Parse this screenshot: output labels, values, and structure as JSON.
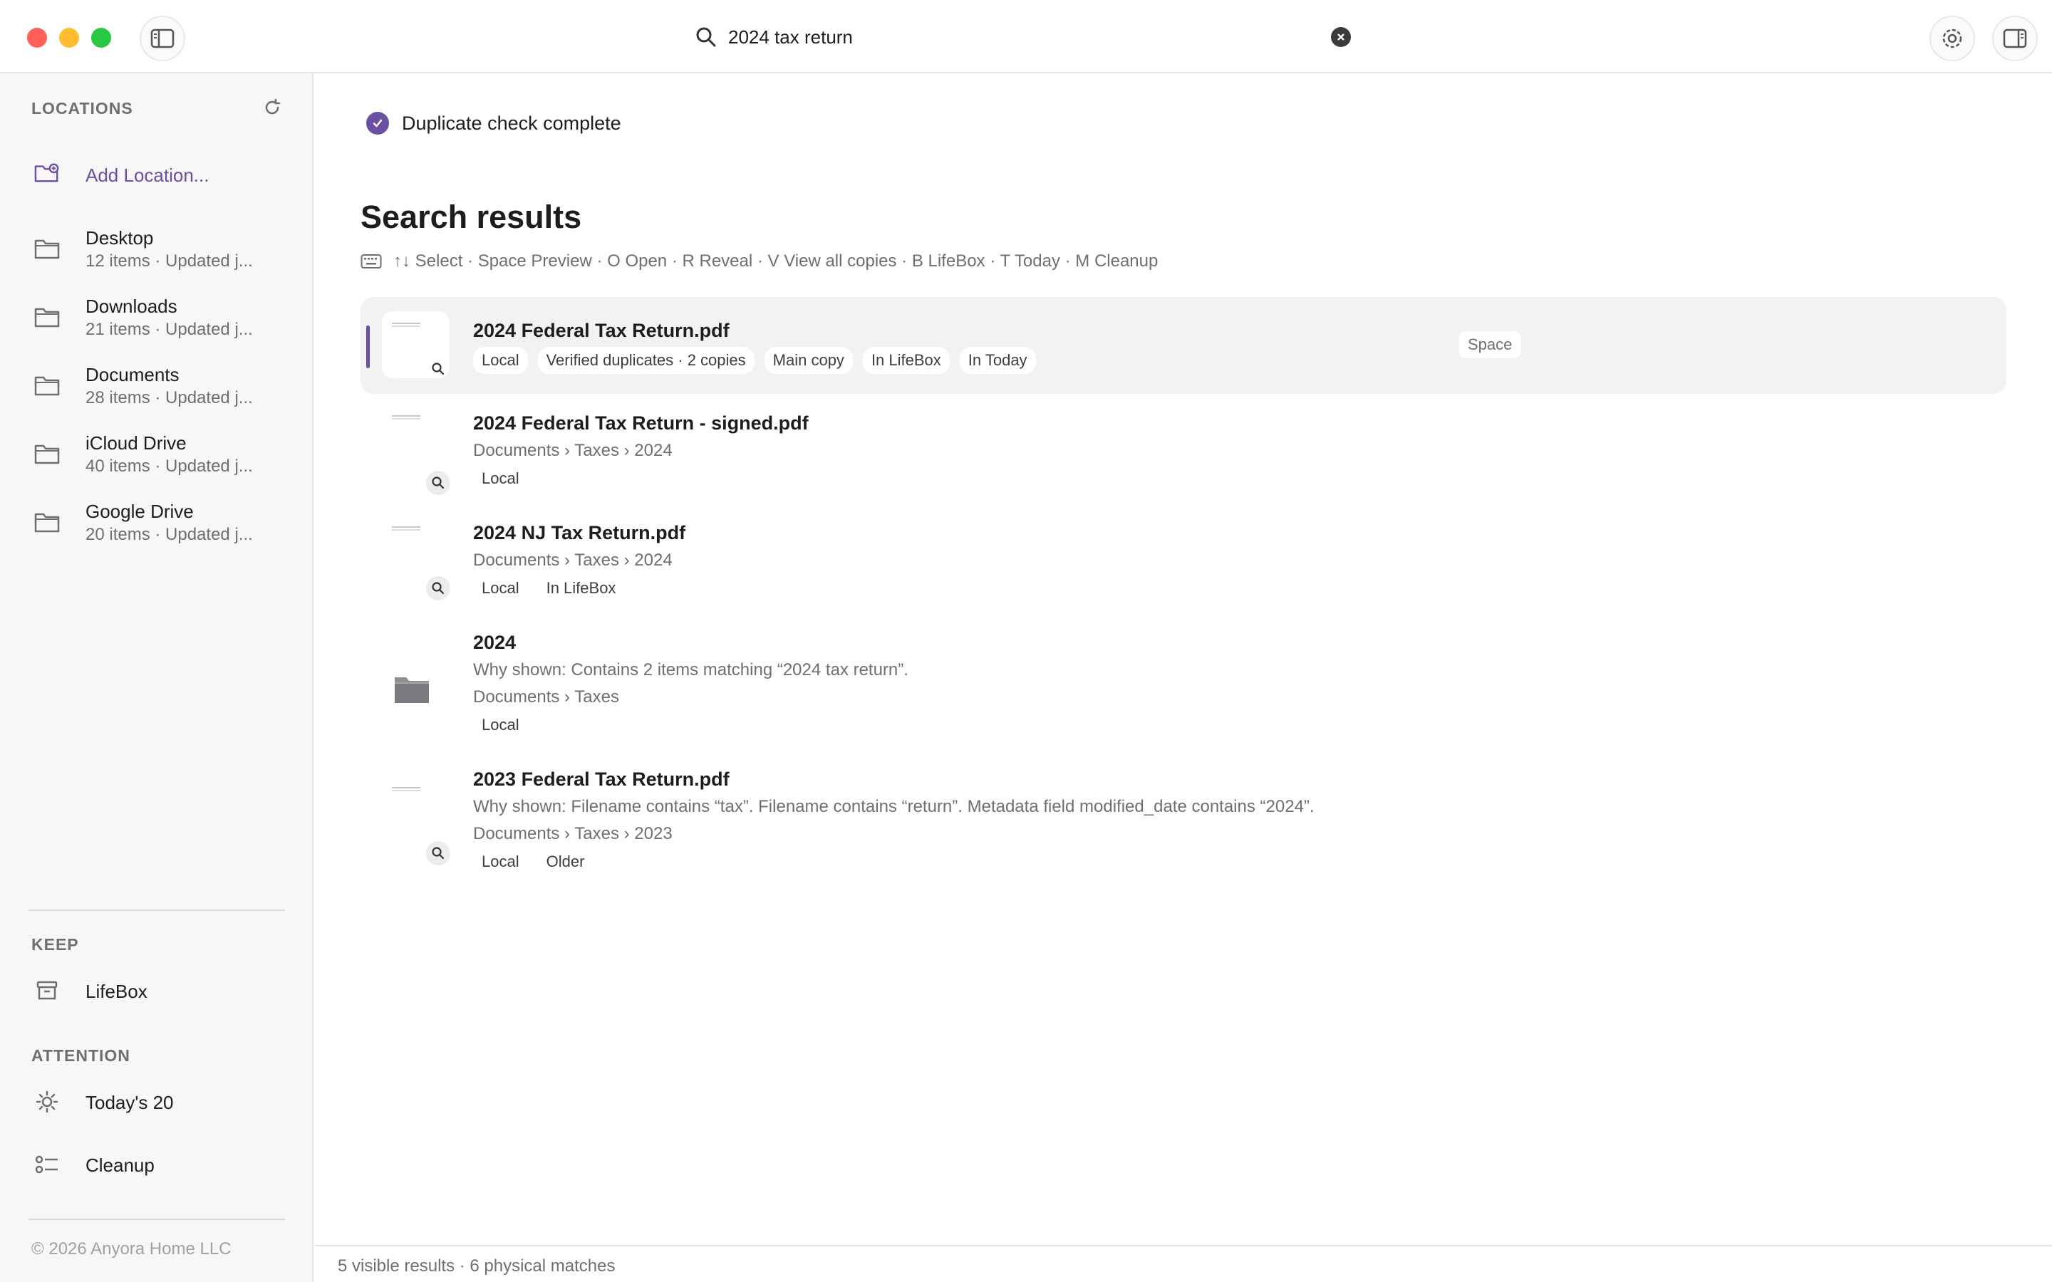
{
  "window": {
    "search_query": "2024 tax return"
  },
  "sidebar": {
    "locations_heading": "LOCATIONS",
    "add_location_label": "Add Location...",
    "locations": [
      {
        "name": "Desktop",
        "meta": "12 items · Updated j..."
      },
      {
        "name": "Downloads",
        "meta": "21 items · Updated j..."
      },
      {
        "name": "Documents",
        "meta": "28 items · Updated j..."
      },
      {
        "name": "iCloud Drive",
        "meta": "40 items · Updated j..."
      },
      {
        "name": "Google Drive",
        "meta": "20 items · Updated j..."
      }
    ],
    "keep_heading": "KEEP",
    "keep_items": [
      {
        "label": "LifeBox",
        "icon": "archive-icon"
      }
    ],
    "attention_heading": "ATTENTION",
    "attention_items": [
      {
        "label": "Today's 20",
        "icon": "sun-icon"
      },
      {
        "label": "Cleanup",
        "icon": "checklist-icon"
      }
    ],
    "copyright": "© 2026 Anyora Home LLC"
  },
  "main": {
    "status": "Duplicate check complete",
    "results_title": "Search results",
    "shortcut_hints": "↑↓ Select · Space Preview · O Open · R Reveal · V View all copies · B LifeBox · T Today · M Cleanup",
    "results": [
      {
        "title": "2024 Federal Tax Return.pdf",
        "tags": [
          "Local",
          "Verified duplicates · 2 copies",
          "Main copy",
          "In LifeBox",
          "In Today"
        ],
        "hint_chip": "Space"
      },
      {
        "title": "2024 Federal Tax Return - signed.pdf",
        "path": "Documents › Taxes › 2024",
        "tags": [
          "Local"
        ]
      },
      {
        "title": "2024 NJ Tax Return.pdf",
        "path": "Documents › Taxes › 2024",
        "tags": [
          "Local",
          "In LifeBox"
        ]
      },
      {
        "title": "2024",
        "why": "Why shown: Contains 2 items matching “2024 tax return”.",
        "path": "Documents › Taxes",
        "tags": [
          "Local"
        ]
      },
      {
        "title": "2023 Federal Tax Return.pdf",
        "why": "Why shown: Filename contains “tax”. Filename contains “return”. Metadata field modified_date contains “2024”.",
        "path": "Documents › Taxes › 2023",
        "tags": [
          "Local",
          "Older"
        ]
      }
    ]
  },
  "footer": {
    "summary": "5 visible results · 6 physical matches"
  },
  "colors": {
    "accent": "#6b4fa0",
    "selected_row_bg": "#f2f2f2",
    "sidebar_bg": "#f7f7f7"
  }
}
